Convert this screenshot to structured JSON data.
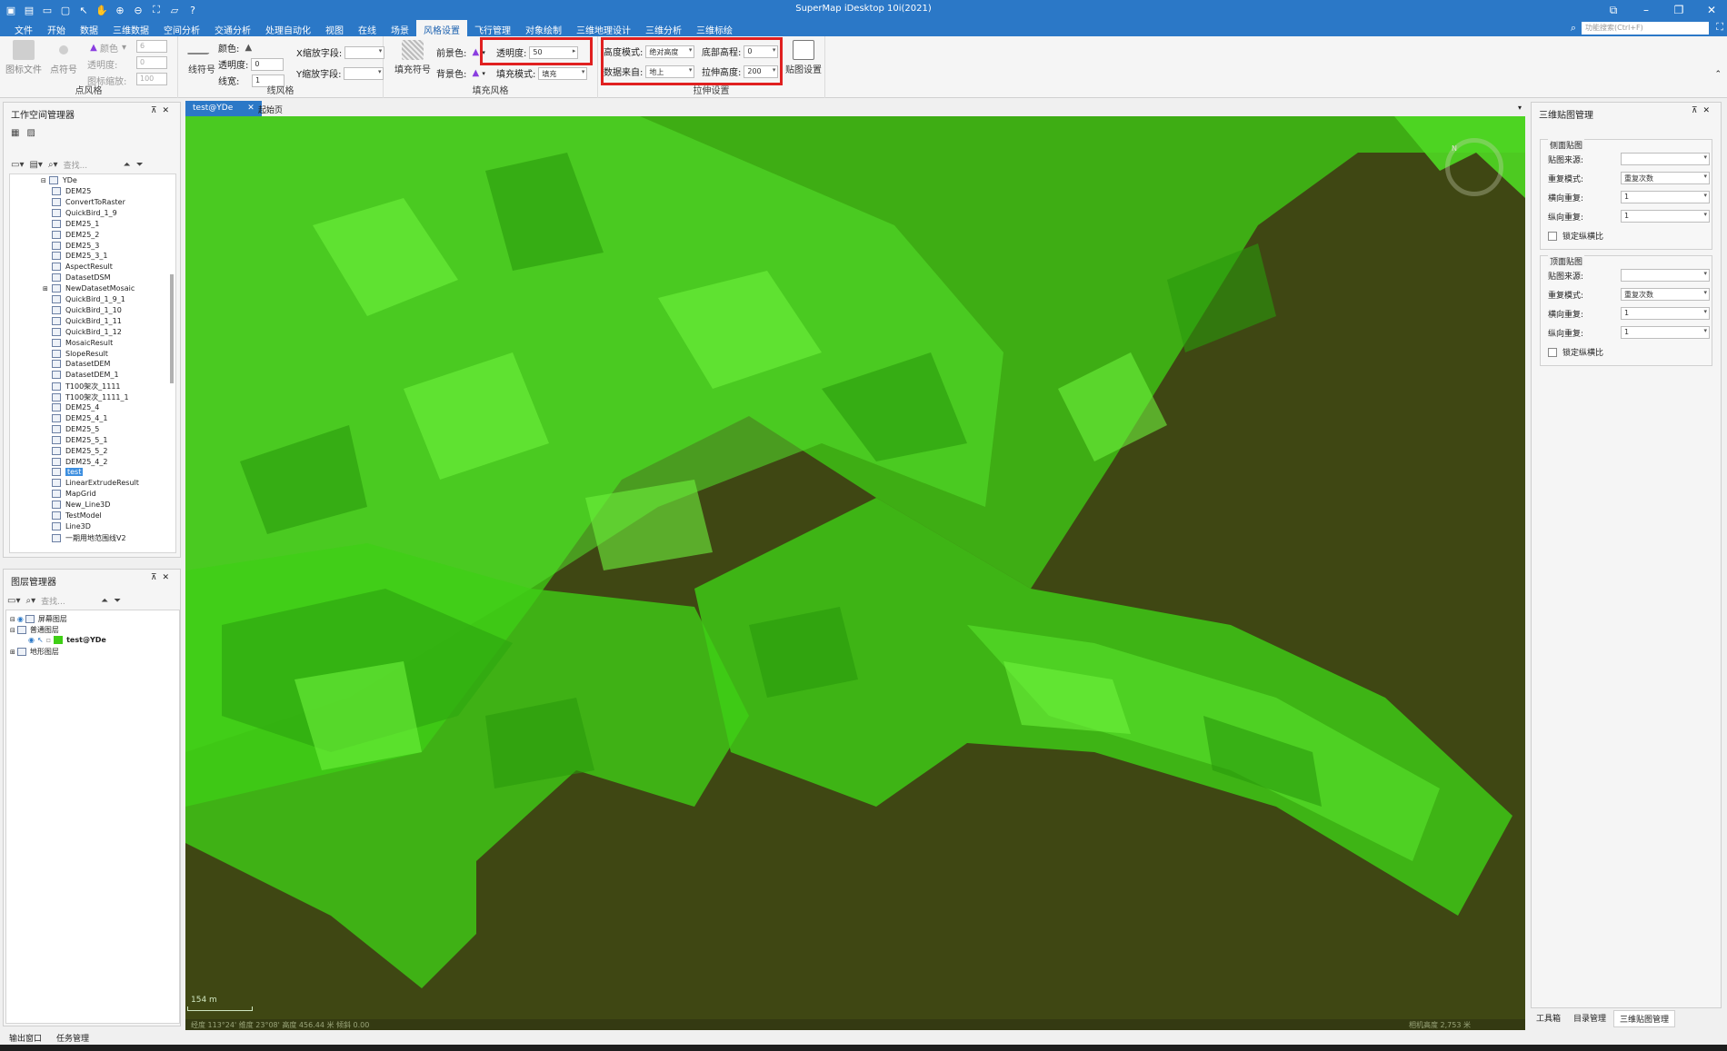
{
  "app": {
    "title": "SuperMap iDesktop 10i(2021)",
    "search_placeholder": "功能搜索(Ctrl+F)"
  },
  "menu": [
    {
      "label": "文件"
    },
    {
      "label": "开始"
    },
    {
      "label": "数据"
    },
    {
      "label": "三维数据"
    },
    {
      "label": "空间分析"
    },
    {
      "label": "交通分析"
    },
    {
      "label": "处理自动化"
    },
    {
      "label": "视图"
    },
    {
      "label": "在线"
    },
    {
      "label": "场景"
    },
    {
      "label": "风格设置",
      "active": true
    },
    {
      "label": "飞行管理"
    },
    {
      "label": "对象绘制"
    },
    {
      "label": "三维地理设计"
    },
    {
      "label": "三维分析"
    },
    {
      "label": "三维标绘"
    }
  ],
  "ribbon": {
    "point_style": {
      "group_label": "点风格",
      "btn_icon_file": "图标文件",
      "btn_point_symbol": "点符号",
      "color_label": "颜色",
      "size_value": "6",
      "transparency_label": "透明度:",
      "transparency_value": "0",
      "icon_scale_label": "图标缩放:",
      "icon_scale_value": "100"
    },
    "line_style": {
      "group_label": "线风格",
      "btn_line_symbol": "线符号",
      "color_label": "颜色:",
      "transparency_label": "透明度:",
      "transparency_value": "0",
      "line_width_label": "线宽:",
      "line_width_value": "1",
      "x_scale_label": "X缩放字段:",
      "y_scale_label": "Y缩放字段:"
    },
    "fill_style": {
      "group_label": "填充风格",
      "btn_fill_symbol": "填充符号",
      "fore_color_label": "前景色:",
      "back_color_label": "背景色:",
      "transparency_label": "透明度:",
      "transparency_value": "50",
      "fill_mode_label": "填充模式:",
      "fill_mode_value": "填充"
    },
    "extrude": {
      "group_label": "拉伸设置",
      "height_mode_label": "高度模式:",
      "height_mode_value": "绝对高度",
      "bottom_alt_label": "底部高程:",
      "bottom_alt_value": "0",
      "data_source_label": "数据来自:",
      "data_source_value": "地上",
      "extrude_height_label": "拉伸高度:",
      "extrude_height_value": "200",
      "btn_texture": "贴图设置"
    }
  },
  "workspace": {
    "title": "工作空间管理器",
    "search_placeholder": "查找...",
    "root": "YDe",
    "items": [
      "DEM25",
      "ConvertToRaster",
      "QuickBird_1_9",
      "DEM25_1",
      "DEM25_2",
      "DEM25_3",
      "DEM25_3_1",
      "AspectResult",
      "DatasetDSM",
      "NewDatasetMosaic",
      "QuickBird_1_9_1",
      "QuickBird_1_10",
      "QuickBird_1_11",
      "QuickBird_1_12",
      "MosaicResult",
      "SlopeResult",
      "DatasetDEM",
      "DatasetDEM_1",
      "T100架次_1111",
      "T100架次_1111_1",
      "DEM25_4",
      "DEM25_4_1",
      "DEM25_5",
      "DEM25_5_1",
      "DEM25_5_2",
      "DEM25_4_2",
      "test",
      "LinearExtrudeResult",
      "MapGrid",
      "New_Line3D",
      "TestModel",
      "Line3D",
      "一期用地范围线V2"
    ],
    "selected": "test"
  },
  "layers": {
    "title": "图层管理器",
    "search_placeholder": "查找...",
    "items": [
      "屏幕图层",
      "普通图层",
      "test@YDe",
      "地形图层"
    ]
  },
  "scene": {
    "tabs": [
      "test@YDe",
      "起始页"
    ],
    "scale_text": "154 m",
    "status_left": "经度 113°24' 维度 23°08' 高度 456.44 米 倾斜 0.00",
    "status_right": "相机高度 2,753 米",
    "background_color": "#3f4713",
    "building_color": "#3fcf16"
  },
  "texture_panel": {
    "title": "三维贴图管理",
    "side_group": "侧面贴图",
    "top_group": "顶面贴图",
    "src_label": "贴图来源:",
    "repeat_mode_label": "重复模式:",
    "repeat_mode_value": "重复次数",
    "h_repeat_label": "横向重复:",
    "h_repeat_value": "1",
    "v_repeat_label": "纵向重复:",
    "v_repeat_value": "1",
    "lock_label": "锁定纵横比"
  },
  "right_tabs": [
    "工具箱",
    "目录管理",
    "三维贴图管理"
  ],
  "bottom_tabs": [
    "输出窗口",
    "任务管理"
  ]
}
